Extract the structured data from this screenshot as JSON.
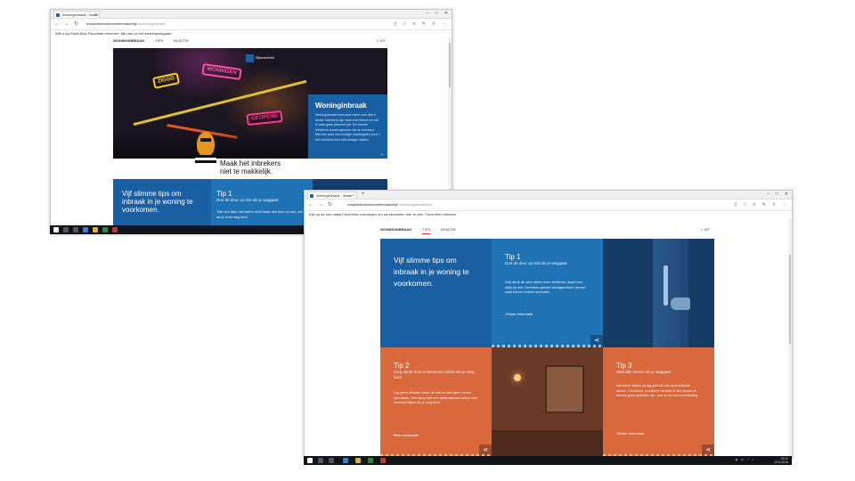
{
  "win1": {
    "tab_title": "Woninginbraak - Maak",
    "url_host": "maakhetinbrekersnietemakkelijk",
    "url_path": ".nl/woninginbraak",
    "favbar_text": "Wilt u uw Extra Kies Favorieten beheren, klik dan op het sterrenpictogram.",
    "site_nav": [
      "WONINGINBRAAK",
      "TIPS",
      "IN ACTIE"
    ],
    "uit_label": "UIT",
    "hero_logo": "Rijksoverheid",
    "neon_signs": [
      "GEOPEND",
      "ZIGGO",
      "WONINGEN"
    ],
    "hero_panel_title": "Woninginbraak",
    "hero_panel_text": "Woninginbraak komt veel vaker voor dan u denkt. Inbrekers zijn vaak snel binnen en het is vaak geen planned job. De meeste inbrekers komen gewoon via de voordeur. Met een paar eenvoudige maatregelen kunt u het inbrekers een stuk lastiger maken.",
    "slogan_line1": "Maak het inbrekers",
    "slogan_line2": "niet te makkelijk.",
    "intro_text": "Vijf slimme tips om inbraak in je woning te voorkomen.",
    "tip1_title": "Tip 1",
    "tip1_sub": "Doe de deur op slot als je weggaat",
    "tip1_body": "Trek een deur niet alleen dicht maar doe hem op slot, ook als je even weg bent."
  },
  "win2": {
    "tab_title": "Woninginbraak - Maak",
    "url_host": "maakhetinbrekersnietemakkelijk",
    "url_path": ".nl/woninginbraak/tips",
    "favbar_text": "Klik op de ster naast Favorieten toevoegen om uw favorieten hier te zien. Favorieten beheren.",
    "site_nav": [
      "WONINGINBRAAK",
      "TIPS",
      "IN ACTIE"
    ],
    "active_nav": "TIPS",
    "uit_label": "UIT",
    "intro_text": "Vijf slimme tips om inbraak in je woning te voorkomen.",
    "tip1": {
      "title": "Tip 1",
      "sub": "Doe de deur op slot als je weggaat",
      "body": "Ook als je de deur alleen even dichttrekt, draai hem altijd op slot. Inbrekers openen dichtgetrokken deuren vaak binnen enkele seconden.",
      "more": "Meer informatie"
    },
    "tip2": {
      "title": "Tip 2",
      "sub": "Zorg dat je huis er bewoond uitziet als je weg bent",
      "body": "Leg geen sleutels onder de mat en laat geen ramen openstaan. Een lamp met een tijdschakelaar laat je huis bewoond lijken als je weg bent.",
      "more": "Meer informatie"
    },
    "tip3": {
      "title": "Tip 3",
      "sub": "Sluit alle ramen als je weggaat",
      "body": "Inbrekers maken graag gebruik van openstaande ramen. Controleer voordat je vertrekt of alle ramen en deuren goed gesloten zijn, ook op de bovenverdieping.",
      "more": "Meer informatie"
    },
    "clock_time": "13:21",
    "clock_date": "12-5-2016"
  },
  "icons": [
    "back-icon",
    "forward-icon",
    "refresh-icon",
    "share-icon",
    "star-icon",
    "contrast-icon"
  ],
  "colors": {
    "blue": "#1b5fa3",
    "blue_mid": "#1f73b5",
    "orange": "#d9683c",
    "red": "#d52b1e",
    "taskbar": "#101418"
  }
}
